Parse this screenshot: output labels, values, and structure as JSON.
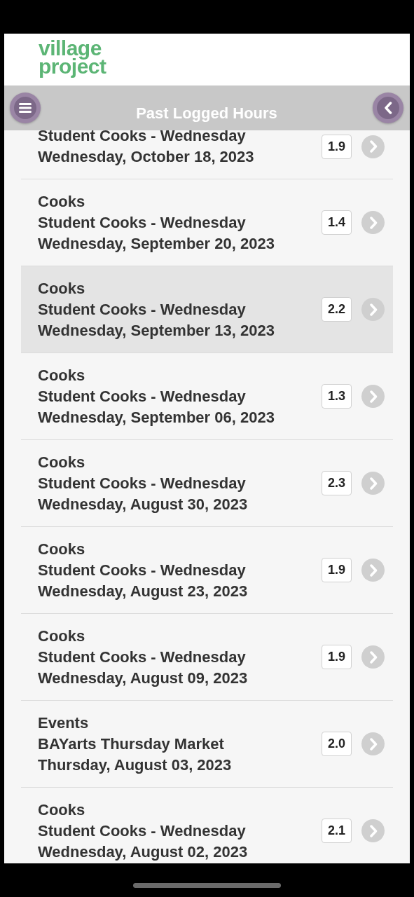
{
  "logo": {
    "line_1": "village",
    "line_2": "project"
  },
  "header": {
    "title": "Past Logged Hours"
  },
  "entries": [
    {
      "activity": "Student Cooks - Wednesday",
      "date": "Wednesday, October 18, 2023",
      "hours": "1.9",
      "selected": false
    },
    {
      "category": "Cooks",
      "activity": "Student Cooks - Wednesday",
      "date": "Wednesday, September 20, 2023",
      "hours": "1.4",
      "selected": false
    },
    {
      "category": "Cooks",
      "activity": "Student Cooks - Wednesday",
      "date": "Wednesday, September 13, 2023",
      "hours": "2.2",
      "selected": true
    },
    {
      "category": "Cooks",
      "activity": "Student Cooks - Wednesday",
      "date": "Wednesday, September 06, 2023",
      "hours": "1.3",
      "selected": false
    },
    {
      "category": "Cooks",
      "activity": "Student Cooks - Wednesday",
      "date": "Wednesday, August 30, 2023",
      "hours": "2.3",
      "selected": false
    },
    {
      "category": "Cooks",
      "activity": "Student Cooks - Wednesday",
      "date": "Wednesday, August 23, 2023",
      "hours": "1.9",
      "selected": false
    },
    {
      "category": "Cooks",
      "activity": "Student Cooks - Wednesday",
      "date": "Wednesday, August 09, 2023",
      "hours": "1.9",
      "selected": false
    },
    {
      "category": "Events",
      "activity": "BAYarts Thursday Market",
      "date": "Thursday, August 03, 2023",
      "hours": "2.0",
      "selected": false
    },
    {
      "category": "Cooks",
      "activity": "Student Cooks - Wednesday",
      "date": "Wednesday, August 02, 2023",
      "hours": "2.1",
      "selected": false
    }
  ]
}
